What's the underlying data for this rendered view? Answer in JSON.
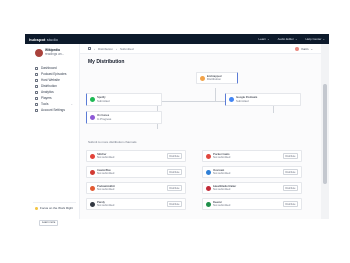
{
  "topbar": {
    "brand_main": "hubspot",
    "brand_rest": " studio",
    "nav": [
      "Learn",
      "Audio Editor",
      "Help Center"
    ]
  },
  "sidebar": {
    "profile_name": "Wikipedia",
    "profile_sub": "readings an...",
    "items": [
      {
        "label": "Dashboard",
        "icon": "grid-icon"
      },
      {
        "label": "Podcast Episodes",
        "icon": "list-icon"
      },
      {
        "label": "Host Website",
        "icon": "globe-icon"
      },
      {
        "label": "Distribution",
        "icon": "share-icon"
      },
      {
        "label": "Analytics",
        "icon": "chart-icon"
      },
      {
        "label": "Players",
        "icon": "play-icon"
      },
      {
        "label": "Tools",
        "icon": "tool-icon",
        "chevron": "⌄"
      },
      {
        "label": "Account Settings",
        "icon": "gear-icon"
      }
    ],
    "promo_text": "Focus on the Work Right",
    "promo_button": "Learn more"
  },
  "crumbs": [
    "Distribution",
    "Submitted"
  ],
  "user_label": "Karin",
  "page_title": "My Distribution",
  "cards_top": {
    "hub": {
      "name": "Embrapped",
      "sub": "Distribution"
    },
    "spotify": {
      "name": "Spotify",
      "sub": "Submitted"
    },
    "google": {
      "name": "Google Podcasts",
      "sub": "Submitted"
    },
    "itunes": {
      "name": "On Itunes",
      "sub": "In Progress"
    }
  },
  "section_label": "Submit to more distribution channels",
  "channels_left": [
    {
      "name": "Stitcher",
      "sub": "Not submitted",
      "action": "Distribute",
      "color": "#e2433a"
    },
    {
      "name": "Castro/Box",
      "sub": "Not submitted",
      "action": "Distribute",
      "color": "#d23b34"
    },
    {
      "name": "PodcastAddict",
      "sub": "Not submitted",
      "action": "Distribute",
      "color": "#e25a33"
    },
    {
      "name": "Pandy",
      "sub": "Not submitted",
      "action": "Distribute",
      "color": "#333842"
    }
  ],
  "channels_right": [
    {
      "name": "Pocket Casts",
      "sub": "Not submitted",
      "action": "Distribute",
      "color": "#e0473e"
    },
    {
      "name": "Overcast",
      "sub": "Not submitted",
      "action": "Distribute",
      "color": "#2f7fd6"
    },
    {
      "name": "iHeartRadio Ratter",
      "sub": "Not submitted",
      "action": "Distribute",
      "color": "#c22a38"
    },
    {
      "name": "Deezer",
      "sub": "Not submitted",
      "action": "Distribute",
      "color": "#1f8f4a"
    }
  ]
}
